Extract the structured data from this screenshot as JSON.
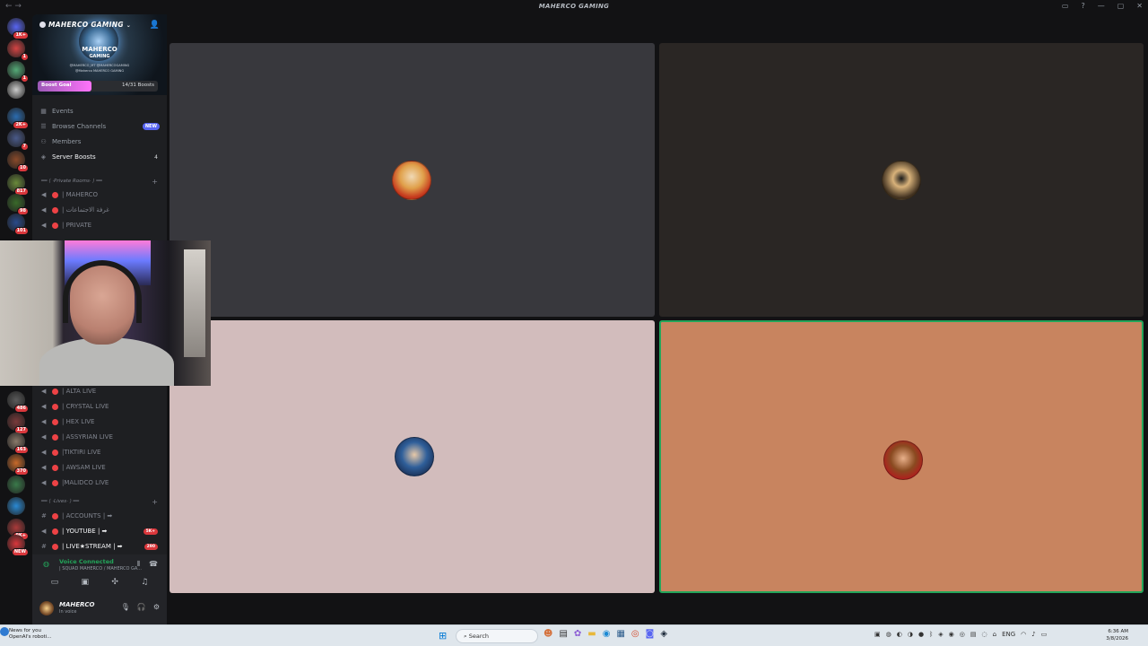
{
  "window": {
    "title": "MAHERCO GAMING"
  },
  "servers": [
    {
      "badge": "1K+",
      "color": "#5865f2"
    },
    {
      "badge": "1",
      "color": "#d44444"
    },
    {
      "badge": "1",
      "color": "#55aa77"
    },
    {
      "badge": "",
      "color": "#cccccc"
    },
    {
      "badge": "2K+",
      "color": "#2b6cb0"
    },
    {
      "badge": "7",
      "color": "#4a5a8a"
    },
    {
      "badge": "10",
      "color": "#8a4a2a"
    },
    {
      "badge": "817",
      "color": "#6a8a3a"
    },
    {
      "badge": "98",
      "color": "#3a6a2a"
    },
    {
      "badge": "101",
      "color": "#2a4a8a"
    },
    {
      "badge": "486",
      "color": "#5a5a5a"
    },
    {
      "badge": "127",
      "color": "#7a3a3a"
    },
    {
      "badge": "163",
      "color": "#8a7a6a"
    },
    {
      "badge": "370",
      "color": "#c86a2a"
    },
    {
      "badge": "",
      "color": "#3a7a4a"
    },
    {
      "badge": "",
      "color": "#2a8ad4"
    },
    {
      "badge": "9K+",
      "color": "#aa3a3a"
    },
    {
      "badge": "NEW",
      "color": "#da373c"
    }
  ],
  "sidebar": {
    "server_name": "MAHERCO GAMING",
    "logo_text": "MAHERCO",
    "logo_sub": "GAMING",
    "banner_line1": "@MAHERCO_MT   @MAHERCOGAMING",
    "banner_line2": "@Maherco   MAHERCO GAMING",
    "boost_label": "Boost Goal",
    "boost_count": "14/31 Boosts",
    "boost_progress": 0.45,
    "nav": {
      "events": "Events",
      "browse": "Browse Channels",
      "new_badge": "NEW",
      "members": "Members",
      "server_boosts": "Server Boosts",
      "server_boosts_count": "4"
    },
    "category_private": "━━ ⟨ ·Private Rooms· ⟩ ━━",
    "private_channels": [
      "| MAHERCO",
      "| غرفة الاجتماعات",
      "| PRIVATE"
    ],
    "live_channels": [
      "| ALTA LIVE",
      "| CRYSTAL LIVE",
      "| HEX LIVE",
      "| ASSYRIAN LIVE",
      "|TIKTIRI LIVE",
      "| AWSAM LIVE",
      "|MALIDCO LIVE"
    ],
    "category_lives": "━━ ⟨ ·Lives· ⟩ ━━",
    "text_channels": [
      {
        "name": "| ACCOUNTS | ➡",
        "badge": ""
      },
      {
        "name": "| YOUTUBE | ➡",
        "badge": "5K+"
      },
      {
        "name": "| LIVE★STREAM | ➡",
        "badge": "290"
      }
    ]
  },
  "voice": {
    "status": "Voice Connected",
    "channel": "| SQUAD MAHERCO / MAHERCO GA..."
  },
  "user": {
    "name": "MAHERCO",
    "status": "In voice"
  },
  "tiles": [
    {
      "bg": "#38383d",
      "avatar": "caesar-avatar"
    },
    {
      "bg": "#2a2624",
      "avatar": "pug-avatar"
    },
    {
      "bg": "#d2bcbc",
      "avatar": "player-avatar"
    },
    {
      "bg": "#c8845f",
      "avatar": "spartan-avatar"
    }
  ],
  "taskbar": {
    "news_title": "News for you",
    "news_sub": "OpenAI's roboti...",
    "search": "Search",
    "lang": "ENG",
    "time": "6:36 AM",
    "date": "3/8/2026"
  }
}
